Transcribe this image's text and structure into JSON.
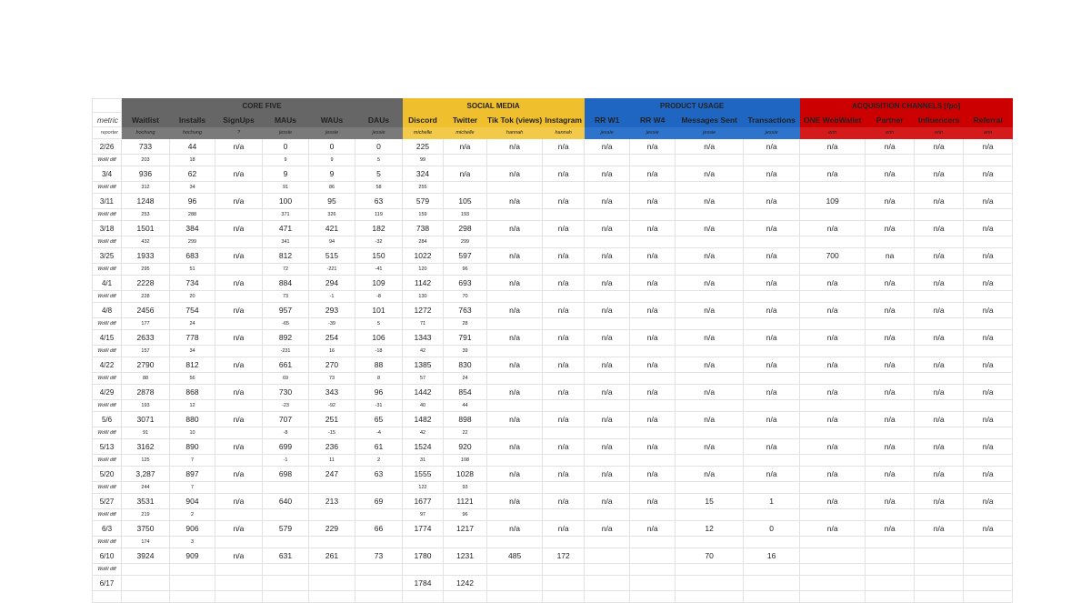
{
  "row_labels": {
    "metric": "metric",
    "reporter": "reporter",
    "wow": "WoW diff"
  },
  "groups": [
    {
      "id": "core",
      "label": "CORE FIVE",
      "color": "#666666",
      "span": 6
    },
    {
      "id": "social",
      "label": "SOCIAL MEDIA",
      "color": "#f0bf2e",
      "span": 4
    },
    {
      "id": "product",
      "label": "PRODUCT USAGE",
      "color": "#1f66c3",
      "span": 4
    },
    {
      "id": "acq",
      "label": "ACQUISITION CHANNELS [fpo]",
      "color": "#cc0000",
      "span": 4
    }
  ],
  "columns": [
    {
      "metric": "Waitlist",
      "reporter": "hochung",
      "group": "core"
    },
    {
      "metric": "Installs",
      "reporter": "hochung",
      "group": "core"
    },
    {
      "metric": "SignUps",
      "reporter": "?",
      "group": "core"
    },
    {
      "metric": "MAUs",
      "reporter": "jessie",
      "group": "core"
    },
    {
      "metric": "WAUs",
      "reporter": "jessie",
      "group": "core"
    },
    {
      "metric": "DAUs",
      "reporter": "jessie",
      "group": "core"
    },
    {
      "metric": "Discord",
      "reporter": "michelle",
      "group": "social"
    },
    {
      "metric": "Twitter",
      "reporter": "michelle",
      "group": "social"
    },
    {
      "metric": "Tik Tok (views)",
      "reporter": "hannah",
      "group": "social"
    },
    {
      "metric": "Instagram",
      "reporter": "hannah",
      "group": "social"
    },
    {
      "metric": "RR W1",
      "reporter": "jessie",
      "group": "product"
    },
    {
      "metric": "RR W4",
      "reporter": "jessie",
      "group": "product"
    },
    {
      "metric": "Messages Sent",
      "reporter": "jessie",
      "group": "product"
    },
    {
      "metric": "Transactions",
      "reporter": "jessie",
      "group": "product"
    },
    {
      "metric": "ONE WebWallet",
      "reporter": "erin",
      "group": "acq"
    },
    {
      "metric": "Partner",
      "reporter": "erin",
      "group": "acq"
    },
    {
      "metric": "Influencers",
      "reporter": "erin",
      "group": "acq"
    },
    {
      "metric": "Referral",
      "reporter": "erin",
      "group": "acq"
    }
  ],
  "rows": [
    {
      "date": "2/26",
      "values": [
        "733",
        "44",
        "n/a",
        "0",
        "0",
        "0",
        "225",
        "n/a",
        "n/a",
        "n/a",
        "n/a",
        "n/a",
        "n/a",
        "n/a",
        "n/a",
        "n/a",
        "n/a",
        "n/a"
      ],
      "wow": [
        "203",
        "18",
        "",
        "9",
        "9",
        "5",
        "99",
        "",
        "",
        "",
        "",
        "",
        "",
        "",
        "",
        "",
        "",
        ""
      ]
    },
    {
      "date": "3/4",
      "values": [
        "936",
        "62",
        "n/a",
        "9",
        "9",
        "5",
        "324",
        "n/a",
        "n/a",
        "n/a",
        "n/a",
        "n/a",
        "n/a",
        "n/a",
        "n/a",
        "n/a",
        "n/a",
        "n/a"
      ],
      "wow": [
        "312",
        "34",
        "",
        "91",
        "86",
        "58",
        "255",
        "",
        "",
        "",
        "",
        "",
        "",
        "",
        "",
        "",
        "",
        ""
      ]
    },
    {
      "date": "3/11",
      "values": [
        "1248",
        "96",
        "n/a",
        "100",
        "95",
        "63",
        "579",
        "105",
        "n/a",
        "n/a",
        "n/a",
        "n/a",
        "n/a",
        "n/a",
        "109",
        "n/a",
        "n/a",
        "n/a"
      ],
      "wow": [
        "253",
        "288",
        "",
        "371",
        "326",
        "119",
        "159",
        "193",
        "",
        "",
        "",
        "",
        "",
        "",
        "",
        "",
        "",
        ""
      ]
    },
    {
      "date": "3/18",
      "values": [
        "1501",
        "384",
        "n/a",
        "471",
        "421",
        "182",
        "738",
        "298",
        "n/a",
        "n/a",
        "n/a",
        "n/a",
        "n/a",
        "n/a",
        "n/a",
        "n/a",
        "n/a",
        "n/a"
      ],
      "wow": [
        "432",
        "299",
        "",
        "341",
        "94",
        "-32",
        "284",
        "299",
        "",
        "",
        "",
        "",
        "",
        "",
        "",
        "",
        "",
        ""
      ]
    },
    {
      "date": "3/25",
      "values": [
        "1933",
        "683",
        "n/a",
        "812",
        "515",
        "150",
        "1022",
        "597",
        "n/a",
        "n/a",
        "n/a",
        "n/a",
        "n/a",
        "n/a",
        "700",
        "na",
        "n/a",
        "n/a"
      ],
      "wow": [
        "295",
        "51",
        "",
        "72",
        "-221",
        "-41",
        "120",
        "96",
        "",
        "",
        "",
        "",
        "",
        "",
        "",
        "",
        "",
        ""
      ]
    },
    {
      "date": "4/1",
      "values": [
        "2228",
        "734",
        "n/a",
        "884",
        "294",
        "109",
        "1142",
        "693",
        "n/a",
        "n/a",
        "n/a",
        "n/a",
        "n/a",
        "n/a",
        "n/a",
        "n/a",
        "n/a",
        "n/a"
      ],
      "wow": [
        "228",
        "20",
        "",
        "73",
        "-1",
        "-8",
        "130",
        "70",
        "",
        "",
        "",
        "",
        "",
        "",
        "",
        "",
        "",
        ""
      ]
    },
    {
      "date": "4/8",
      "values": [
        "2456",
        "754",
        "n/a",
        "957",
        "293",
        "101",
        "1272",
        "763",
        "n/a",
        "n/a",
        "n/a",
        "n/a",
        "n/a",
        "n/a",
        "n/a",
        "n/a",
        "n/a",
        "n/a"
      ],
      "wow": [
        "177",
        "24",
        "",
        "-65",
        "-39",
        "5",
        "71",
        "28",
        "",
        "",
        "",
        "",
        "",
        "",
        "",
        "",
        "",
        ""
      ]
    },
    {
      "date": "4/15",
      "values": [
        "2633",
        "778",
        "n/a",
        "892",
        "254",
        "106",
        "1343",
        "791",
        "n/a",
        "n/a",
        "n/a",
        "n/a",
        "n/a",
        "n/a",
        "n/a",
        "n/a",
        "n/a",
        "n/a"
      ],
      "wow": [
        "157",
        "34",
        "",
        "-231",
        "16",
        "-18",
        "42",
        "39",
        "",
        "",
        "",
        "",
        "",
        "",
        "",
        "",
        "",
        ""
      ]
    },
    {
      "date": "4/22",
      "values": [
        "2790",
        "812",
        "n/a",
        "661",
        "270",
        "88",
        "1385",
        "830",
        "n/a",
        "n/a",
        "n/a",
        "n/a",
        "n/a",
        "n/a",
        "n/a",
        "n/a",
        "n/a",
        "n/a"
      ],
      "wow": [
        "88",
        "56",
        "",
        "69",
        "73",
        "8",
        "57",
        "24",
        "",
        "",
        "",
        "",
        "",
        "",
        "",
        "",
        "",
        ""
      ]
    },
    {
      "date": "4/29",
      "values": [
        "2878",
        "868",
        "n/a",
        "730",
        "343",
        "96",
        "1442",
        "854",
        "n/a",
        "n/a",
        "n/a",
        "n/a",
        "n/a",
        "n/a",
        "n/a",
        "n/a",
        "n/a",
        "n/a"
      ],
      "wow": [
        "193",
        "12",
        "",
        "-23",
        "-92",
        "-31",
        "40",
        "44",
        "",
        "",
        "",
        "",
        "",
        "",
        "",
        "",
        "",
        ""
      ]
    },
    {
      "date": "5/6",
      "values": [
        "3071",
        "880",
        "n/a",
        "707",
        "251",
        "65",
        "1482",
        "898",
        "n/a",
        "n/a",
        "n/a",
        "n/a",
        "n/a",
        "n/a",
        "n/a",
        "n/a",
        "n/a",
        "n/a"
      ],
      "wow": [
        "91",
        "10",
        "",
        "-8",
        "-15",
        "-4",
        "42",
        "22",
        "",
        "",
        "",
        "",
        "",
        "",
        "",
        "",
        "",
        ""
      ]
    },
    {
      "date": "5/13",
      "values": [
        "3162",
        "890",
        "n/a",
        "699",
        "236",
        "61",
        "1524",
        "920",
        "n/a",
        "n/a",
        "n/a",
        "n/a",
        "n/a",
        "n/a",
        "n/a",
        "n/a",
        "n/a",
        "n/a"
      ],
      "wow": [
        "125",
        "7",
        "",
        "-1",
        "11",
        "2",
        "31",
        "108",
        "",
        "",
        "",
        "",
        "",
        "",
        "",
        "",
        "",
        ""
      ]
    },
    {
      "date": "5/20",
      "values": [
        "3,287",
        "897",
        "n/a",
        "698",
        "247",
        "63",
        "1555",
        "1028",
        "n/a",
        "n/a",
        "n/a",
        "n/a",
        "n/a",
        "n/a",
        "n/a",
        "n/a",
        "n/a",
        "n/a"
      ],
      "wow": [
        "244",
        "7",
        "",
        "",
        "",
        "",
        "122",
        "93",
        "",
        "",
        "",
        "",
        "",
        "",
        "",
        "",
        "",
        ""
      ]
    },
    {
      "date": "5/27",
      "values": [
        "3531",
        "904",
        "n/a",
        "640",
        "213",
        "69",
        "1677",
        "1121",
        "n/a",
        "n/a",
        "n/a",
        "n/a",
        "15",
        "1",
        "n/a",
        "n/a",
        "n/a",
        "n/a"
      ],
      "wow": [
        "219",
        "2",
        "",
        "",
        "",
        "",
        "97",
        "96",
        "",
        "",
        "",
        "",
        "",
        "",
        "",
        "",
        "",
        ""
      ]
    },
    {
      "date": "6/3",
      "values": [
        "3750",
        "906",
        "n/a",
        "579",
        "229",
        "66",
        "1774",
        "1217",
        "n/a",
        "n/a",
        "n/a",
        "n/a",
        "12",
        "0",
        "n/a",
        "n/a",
        "n/a",
        "n/a"
      ],
      "wow": [
        "174",
        "3",
        "",
        "",
        "",
        "",
        "",
        "",
        "",
        "",
        "",
        "",
        "",
        "",
        "",
        "",
        "",
        ""
      ]
    },
    {
      "date": "6/10",
      "values": [
        "3924",
        "909",
        "n/a",
        "631",
        "261",
        "73",
        "1780",
        "1231",
        "485",
        "172",
        "",
        "",
        "70",
        "16",
        "",
        "",
        "",
        ""
      ],
      "wow": [
        "",
        "",
        "",
        "",
        "",
        "",
        "",
        "",
        "",
        "",
        "",
        "",
        "",
        "",
        "",
        "",
        "",
        ""
      ]
    },
    {
      "date": "6/17",
      "values": [
        "",
        "",
        "",
        "",
        "",
        "",
        "1784",
        "1242",
        "",
        "",
        "",
        "",
        "",
        "",
        "",
        "",
        "",
        ""
      ],
      "wow": null
    }
  ]
}
